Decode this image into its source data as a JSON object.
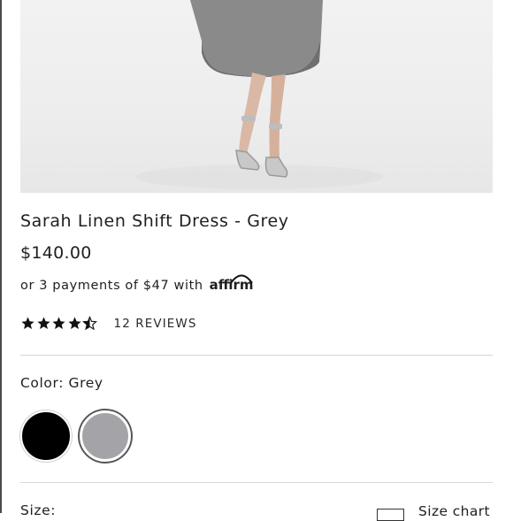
{
  "product": {
    "title": "Sarah Linen Shift Dress - Grey",
    "price": "$140.00",
    "installment_text": "or 3 payments of $47 with",
    "installment_provider": "affirm",
    "rating": 4.5,
    "reviews_label": "12 REVIEWS"
  },
  "color": {
    "label": "Color: Grey",
    "swatches": [
      {
        "name": "Black",
        "hex": "#000000",
        "selected": false
      },
      {
        "name": "Grey",
        "hex": "#a4a4a8",
        "selected": true
      }
    ]
  },
  "size": {
    "label": "Size:",
    "chart_label": "Size chart"
  }
}
